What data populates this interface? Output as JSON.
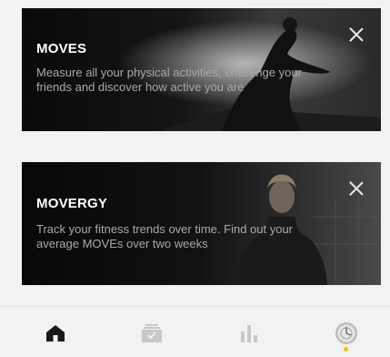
{
  "cards": [
    {
      "title": "MOVES",
      "description": "Measure all your physical activities, challenge your friends and discover how active you are",
      "close_icon": "close-icon"
    },
    {
      "title": "MOVERGY",
      "description": "Track your fitness trends over time. Find out your average MOVEs over two weeks",
      "close_icon": "close-icon"
    }
  ],
  "bottom_nav": {
    "items": [
      {
        "icon": "home-icon",
        "active": true
      },
      {
        "icon": "inbox-icon",
        "active": false
      },
      {
        "icon": "bar-chart-icon",
        "active": false
      },
      {
        "icon": "watch-icon",
        "active": false
      }
    ],
    "indicator_color": "#f5c400"
  },
  "colors": {
    "background": "#f2f2f2",
    "card_background": "#0d0d0d",
    "title": "#ffffff",
    "description": "#a9a9a9",
    "nav_active": "#1a1a1a",
    "nav_inactive": "#c8c8c8"
  }
}
